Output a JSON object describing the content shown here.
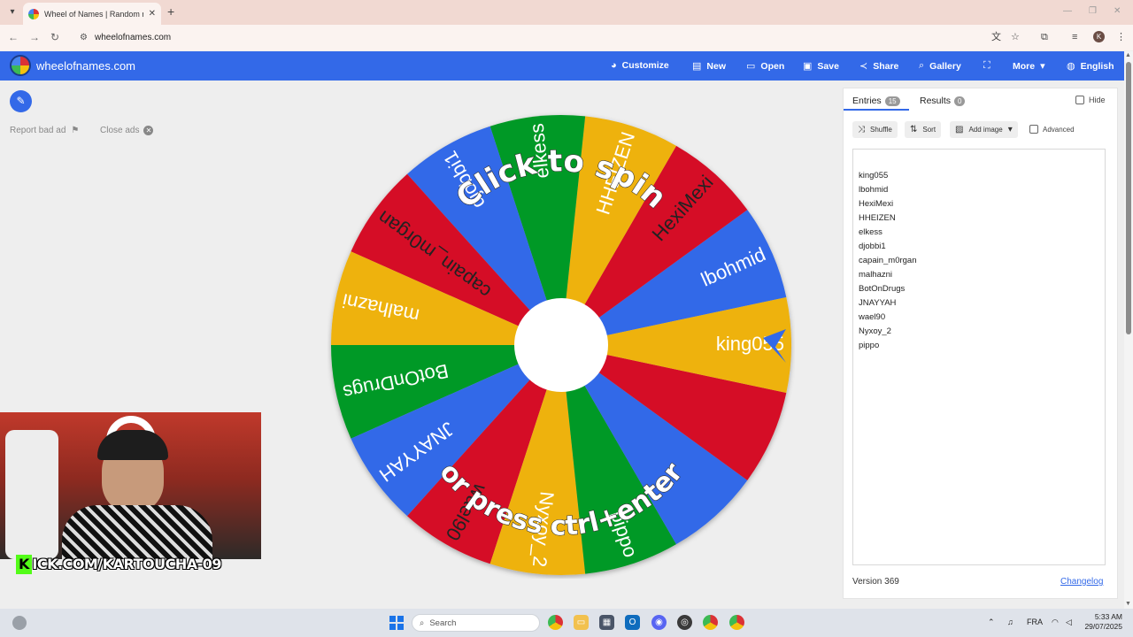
{
  "browser": {
    "tab_title": "Wheel of Names | Random nam",
    "url": "wheelofnames.com"
  },
  "header": {
    "site_name": "wheelofnames.com",
    "menu": [
      {
        "label": "Customize",
        "icon": "palette-icon"
      },
      {
        "label": "New",
        "icon": "file-icon"
      },
      {
        "label": "Open",
        "icon": "folder-icon"
      },
      {
        "label": "Save",
        "icon": "save-icon"
      },
      {
        "label": "Share",
        "icon": "share-icon"
      },
      {
        "label": "Gallery",
        "icon": "search-icon"
      },
      {
        "label": "",
        "icon": "fullscreen-icon"
      },
      {
        "label": "More",
        "icon": "chevron-down-icon"
      },
      {
        "label": "English",
        "icon": "globe-icon"
      }
    ],
    "bg_color": "#3369e8"
  },
  "left": {
    "report_ad": "Report bad ad",
    "close_ads": "Close ads"
  },
  "wheel": {
    "pointer_at": "king055",
    "overlay_top": "Click to spin",
    "overlay_bottom": "or press ctrl+enter",
    "segments": [
      {
        "label": "king055",
        "color": "#3369e8"
      },
      {
        "label": "lbohmid",
        "color": "#d50f25"
      },
      {
        "label": "HexiMexi",
        "color": "#eeb211"
      },
      {
        "label": "HHEIZEN",
        "color": "#009925"
      },
      {
        "label": "elkess",
        "color": "#3369e8"
      },
      {
        "label": "djobbi1",
        "color": "#d50f25"
      },
      {
        "label": "capain_m0rgan",
        "color": "#eeb211"
      },
      {
        "label": "malhazni",
        "color": "#009925"
      },
      {
        "label": "BotOnDrugs",
        "color": "#3369e8"
      },
      {
        "label": "JNAYYAH",
        "color": "#d50f25"
      },
      {
        "label": "wael90",
        "color": "#eeb211"
      },
      {
        "label": "Nyxoy_2",
        "color": "#009925"
      },
      {
        "label": "pippo",
        "color": "#3369e8"
      },
      {
        "label": "",
        "color": "#d50f25"
      },
      {
        "label": "",
        "color": "#eeb211"
      }
    ]
  },
  "stream": {
    "kick_letter": "K",
    "kick_url": "ICK.COM/KARTOUCHA-09"
  },
  "panel": {
    "entries_tab": "Entries",
    "entries_count": "15",
    "results_tab": "Results",
    "results_count": "0",
    "hide_label": "Hide",
    "shuffle": "Shuffle",
    "sort": "Sort",
    "add_image": "Add image",
    "advanced": "Advanced",
    "entries": [
      "king055",
      "lbohmid",
      "HexiMexi",
      "HHEIZEN",
      "elkess",
      "djobbi1",
      "capain_m0rgan",
      "malhazni",
      "BotOnDrugs",
      "JNAYYAH",
      "wael90",
      "Nyxoy_2",
      "pippo"
    ],
    "version": "Version 369",
    "changelog": "Changelog"
  },
  "taskbar": {
    "search_placeholder": "Search",
    "lang": "FRA",
    "time": "5:33 AM",
    "date": "29/07/2025"
  }
}
